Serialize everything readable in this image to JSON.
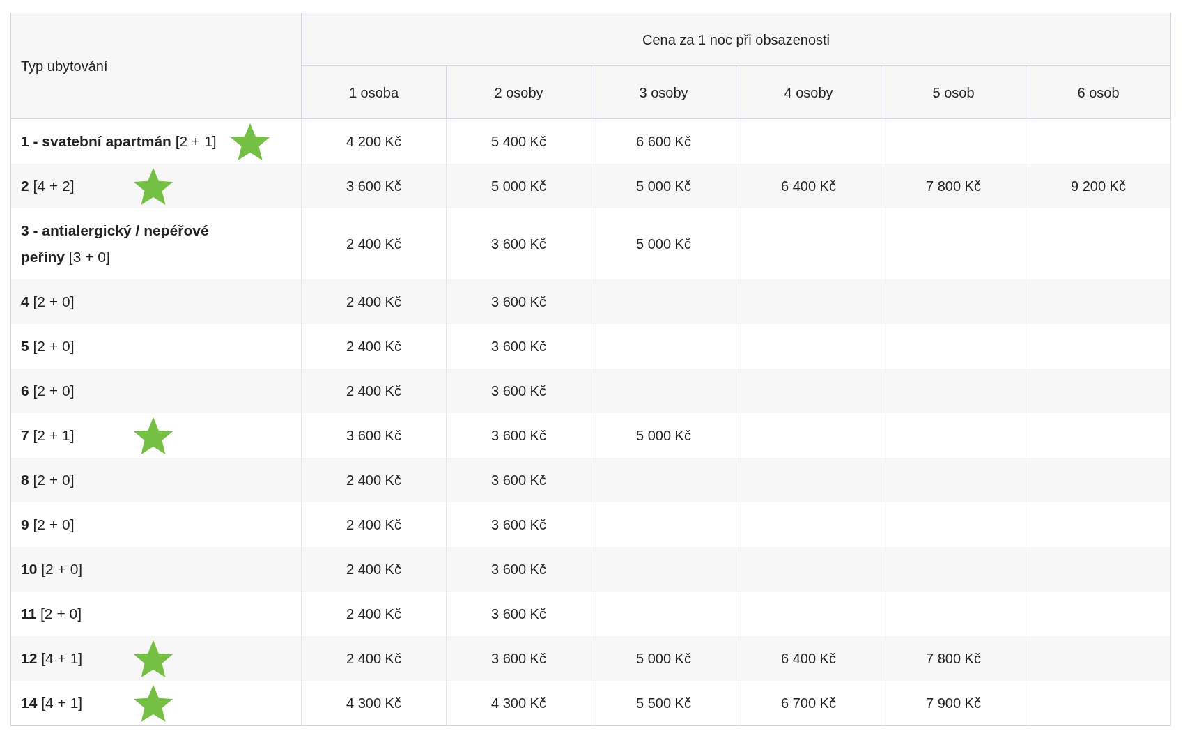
{
  "table": {
    "corner_header": "Typ ubytování",
    "group_header": "Cena za 1 noc při obsazenosti",
    "columns": [
      "1 osoba",
      "2 osoby",
      "3 osoby",
      "4 osoby",
      "5 osob",
      "6 osob"
    ],
    "rows": [
      {
        "name": "**1 - svatební apartmán** [2 + 1]",
        "starred": true,
        "prices": [
          "4 200 Kč",
          "5 400 Kč",
          "6 600 Kč"
        ]
      },
      {
        "name": "**2** [4 + 2]",
        "starred": true,
        "prices": [
          "3 600 Kč",
          "5 000 Kč",
          "5 000 Kč",
          "6 400 Kč",
          "7 800 Kč",
          "9 200 Kč"
        ]
      },
      {
        "name": "**3 - antialergický / nepéřové peřiny** [3 + 0]",
        "starred": false,
        "prices": [
          "2 400 Kč",
          "3 600 Kč",
          "5 000 Kč"
        ]
      },
      {
        "name": "**4** [2 + 0]",
        "starred": false,
        "prices": [
          "2 400 Kč",
          "3 600 Kč"
        ]
      },
      {
        "name": "**5** [2 + 0]",
        "starred": false,
        "prices": [
          "2 400 Kč",
          "3 600 Kč"
        ]
      },
      {
        "name": "**6** [2 + 0]",
        "starred": false,
        "prices": [
          "2 400 Kč",
          "3 600 Kč"
        ]
      },
      {
        "name": "**7** [2 + 1]",
        "starred": true,
        "prices": [
          "3 600 Kč",
          "3 600 Kč",
          "5 000 Kč"
        ]
      },
      {
        "name": "**8** [2 + 0]",
        "starred": false,
        "prices": [
          "2 400 Kč",
          "3 600 Kč"
        ]
      },
      {
        "name": "**9** [2 + 0]",
        "starred": false,
        "prices": [
          "2 400 Kč",
          "3 600 Kč"
        ]
      },
      {
        "name": "**10** [2 + 0]",
        "starred": false,
        "prices": [
          "2 400 Kč",
          "3 600 Kč"
        ]
      },
      {
        "name": "**11** [2 + 0]",
        "starred": false,
        "prices": [
          "2 400 Kč",
          "3 600 Kč"
        ]
      },
      {
        "name": "**12** [4 + 1]",
        "starred": true,
        "prices": [
          "2 400 Kč",
          "3 600 Kč",
          "5 000 Kč",
          "6 400 Kč",
          "7 800 Kč"
        ]
      },
      {
        "name": "**14** [4 + 1]",
        "starred": true,
        "prices": [
          "4 300 Kč",
          "4 300 Kč",
          "5 500 Kč",
          "6 700 Kč",
          "7 900 Kč"
        ]
      }
    ]
  }
}
